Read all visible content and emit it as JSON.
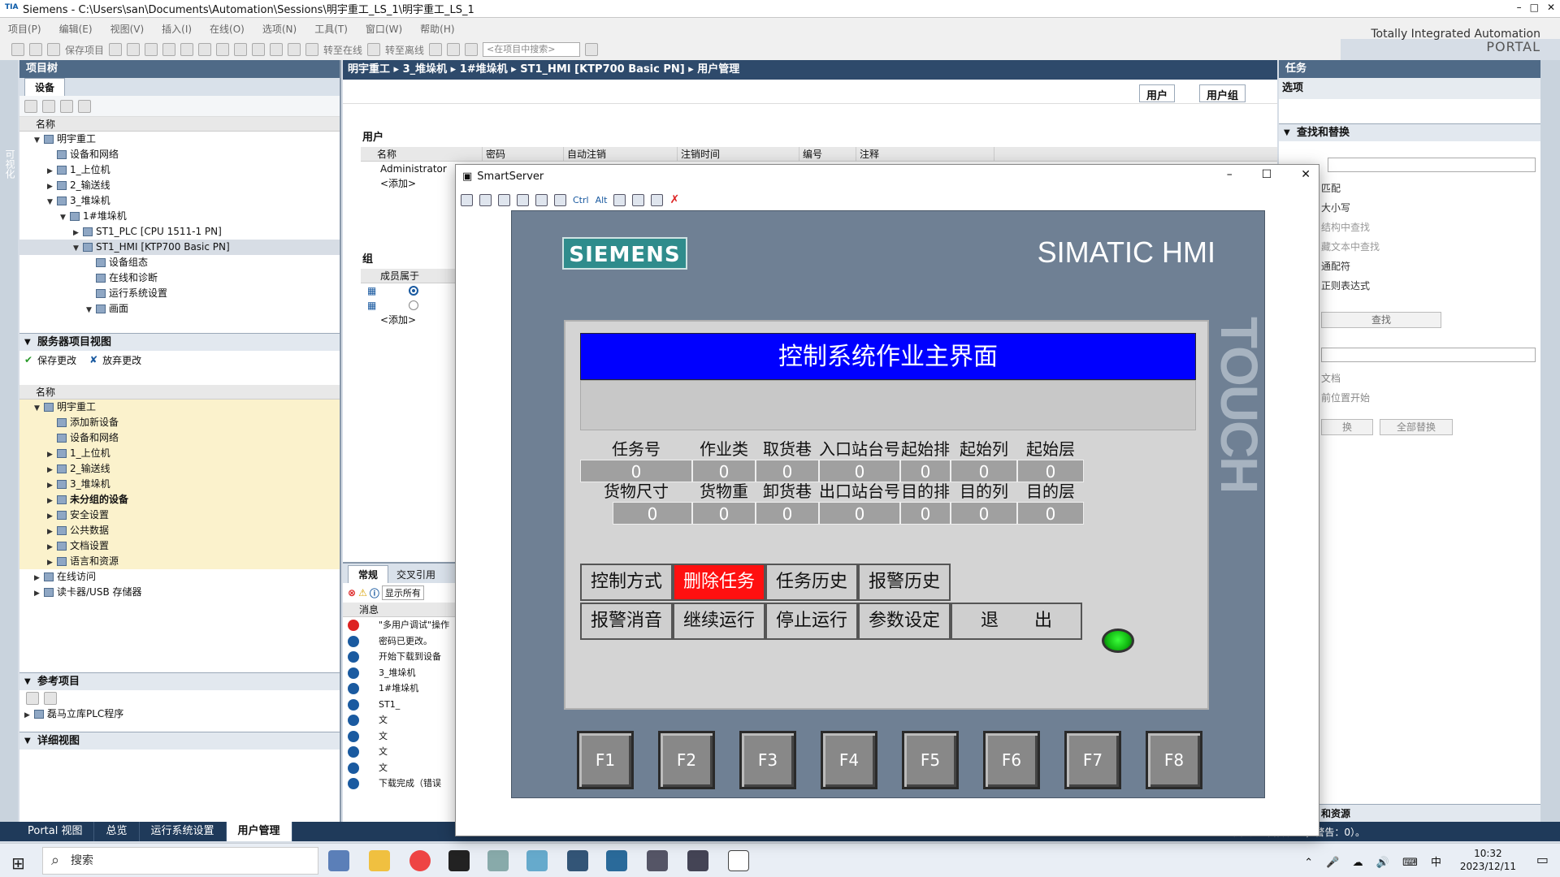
{
  "window": {
    "title": "Siemens  -  C:\\Users\\san\\Documents\\Automation\\Sessions\\明宇重工_LS_1\\明宇重工_LS_1",
    "controls": [
      "–",
      "□",
      "✕"
    ]
  },
  "menu": [
    "项目(P)",
    "编辑(E)",
    "视图(V)",
    "插入(I)",
    "在线(O)",
    "选项(N)",
    "工具(T)",
    "窗口(W)",
    "帮助(H)"
  ],
  "brand": {
    "line1": "Totally Integrated Automation",
    "line2": "PORTAL"
  },
  "toolbar": {
    "save_label": "保存项目",
    "go_online": "转至在线",
    "go_offline": "转至离线",
    "search_placeholder": "<在项目中搜索>"
  },
  "left": {
    "title": "项目树",
    "tab": "设备",
    "col_name": "名称",
    "tree": [
      {
        "label": "明宇重工",
        "level": 0,
        "arrow": "▼"
      },
      {
        "label": "设备和网络",
        "level": 1,
        "arrow": ""
      },
      {
        "label": "1_上位机",
        "level": 1,
        "arrow": "▶"
      },
      {
        "label": "2_输送线",
        "level": 1,
        "arrow": "▶"
      },
      {
        "label": "3_堆垛机",
        "level": 1,
        "arrow": "▼"
      },
      {
        "label": "1#堆垛机",
        "level": 2,
        "arrow": "▼"
      },
      {
        "label": "ST1_PLC [CPU 1511-1 PN]",
        "level": 3,
        "arrow": "▶"
      },
      {
        "label": "ST1_HMI [KTP700 Basic PN]",
        "level": 3,
        "arrow": "▼"
      },
      {
        "label": "设备组态",
        "level": 4,
        "arrow": ""
      },
      {
        "label": "在线和诊断",
        "level": 4,
        "arrow": ""
      },
      {
        "label": "运行系统设置",
        "level": 4,
        "arrow": ""
      },
      {
        "label": "画面",
        "level": 4,
        "arrow": "▼"
      }
    ],
    "server_view": "服务器项目视图",
    "save_changes": "保存更改",
    "discard_changes": "放弃更改",
    "server_tree": [
      {
        "label": "明宇重工",
        "level": 0,
        "arrow": "▼"
      },
      {
        "label": "添加新设备",
        "level": 1,
        "arrow": ""
      },
      {
        "label": "设备和网络",
        "level": 1,
        "arrow": ""
      },
      {
        "label": "1_上位机",
        "level": 1,
        "arrow": "▶"
      },
      {
        "label": "2_输送线",
        "level": 1,
        "arrow": "▶"
      },
      {
        "label": "3_堆垛机",
        "level": 1,
        "arrow": "▶"
      },
      {
        "label": "未分组的设备",
        "level": 1,
        "arrow": "▶",
        "bold": true
      },
      {
        "label": "安全设置",
        "level": 1,
        "arrow": "▶"
      },
      {
        "label": "公共数据",
        "level": 1,
        "arrow": "▶"
      },
      {
        "label": "文档设置",
        "level": 1,
        "arrow": "▶"
      },
      {
        "label": "语言和资源",
        "level": 1,
        "arrow": "▶"
      },
      {
        "label": "在线访问",
        "level": 0,
        "arrow": "▶",
        "white": true
      },
      {
        "label": "读卡器/USB 存储器",
        "level": 0,
        "arrow": "▶",
        "white": true
      }
    ],
    "ref_title": "参考项目",
    "ref_item": "磊马立库PLC程序",
    "detail_title": "详细视图",
    "side_label": "可视化"
  },
  "center": {
    "breadcrumb": "明宇重工  ▸  3_堆垛机  ▸  1#堆垛机  ▸  ST1_HMI [KTP700 Basic PN]  ▸  用户管理",
    "tab_users": "用户",
    "tab_groups": "用户组",
    "users_title": "用户",
    "cols": [
      "名称",
      "密码",
      "自动注销",
      "注销时间",
      "编号",
      "注释"
    ],
    "row1": "Administrator",
    "add": "<添加>",
    "group_title": "组",
    "member_of": "成员属于",
    "msg_tab1": "常规",
    "msg_tab2": "交叉引用",
    "msg_show_all": "显示所有",
    "msg_col": "消息",
    "messages": [
      "\"多用户调试\"操作",
      "密码已更改。",
      "开始下载到设备",
      "3_堆垛机",
      "1#堆垛机",
      "ST1_",
      "文",
      "文",
      "文",
      "文",
      "下载完成（错误"
    ]
  },
  "right": {
    "title": "任务",
    "options": "选项",
    "find_replace": "查找和替换",
    "opts": [
      "匹配",
      "大小写",
      "结构中查找",
      "藏文本中查找",
      "通配符",
      "正则表达式"
    ],
    "find_btn": "查找",
    "opts2": [
      "文档",
      "前位置开始"
    ],
    "replace_btn": "换",
    "replace_all": "全部替换",
    "lang_title": "和资源",
    "status": "载完成（错误：0；警告：0）。"
  },
  "portalbar": {
    "portal": "Portal 视图",
    "overview": "总览",
    "runtime": "运行系统设置",
    "usermgmt": "用户管理"
  },
  "taskbar": {
    "search": "搜索",
    "time": "10:32",
    "date": "2023/12/11",
    "ime": "中"
  },
  "smartserver": {
    "title": "SmartServer",
    "ctrl_label": "Ctrl",
    "alt_label": "Alt",
    "brand_logo": "SIEMENS",
    "brand_model": "SIMATIC HMI",
    "touch": "TOUCH",
    "screen_title": "控制系统作业主界面",
    "labels_row1": [
      "任务号",
      "作业类型",
      "取货巷道",
      "入口站台号",
      "起始排",
      "起始列",
      "起始层"
    ],
    "values_row1": [
      "0",
      "0",
      "0",
      "0",
      "0",
      "0",
      "0"
    ],
    "labels_row2": [
      "货物尺寸",
      "货物重量",
      "卸货巷道",
      "出口站台号",
      "目的排",
      "目的列",
      "目的层"
    ],
    "values_row2": [
      "0",
      "0",
      "0",
      "0",
      "0",
      "0",
      "0"
    ],
    "buttons_row1": [
      "控制方式",
      "删除任务",
      "任务历史",
      "报警历史"
    ],
    "buttons_row2": [
      "报警消音",
      "继续运行",
      "停止运行",
      "参数设定",
      "退　　出"
    ],
    "fkeys": [
      "F1",
      "F2",
      "F3",
      "F4",
      "F5",
      "F6",
      "F7",
      "F8"
    ],
    "colors": {
      "header": "#0000ff",
      "delete": "#ff1010",
      "led": "#22dd22"
    }
  }
}
